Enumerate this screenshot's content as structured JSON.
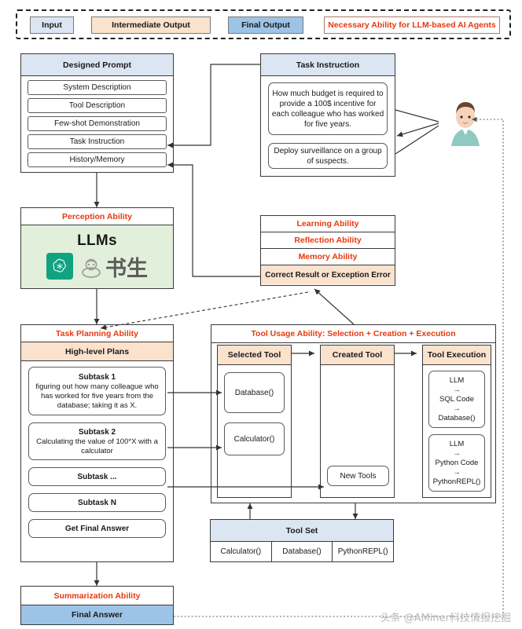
{
  "legend": {
    "input": "Input",
    "intermediate": "Intermediate Output",
    "final": "Final Output",
    "necessary": "Necessary Ability for LLM-based AI Agents",
    "colors": {
      "input": "#dce6f2",
      "intermediate": "#fbe2cd",
      "final": "#9dc3e6",
      "ability_text": "#e8380d"
    }
  },
  "designed_prompt": {
    "title": "Designed Prompt",
    "items": [
      "System Description",
      "Tool Description",
      "Few-shot Demonstration",
      "Task Instruction",
      "History/Memory"
    ]
  },
  "task_instruction": {
    "title": "Task Instruction",
    "items": [
      "How much budget is required to provide a 100$ incentive for each colleague who has worked for five years.",
      "Deploy surveillance on a group of suspects."
    ]
  },
  "perception": {
    "title": "Perception Ability",
    "model_label": "LLMs",
    "logos": [
      "openai-logo",
      "internlm-logo"
    ],
    "internlm_text": "书生",
    "background": "#e2efda"
  },
  "abilities": {
    "learning": "Learning Ability",
    "reflection": "Reflection Ability",
    "memory": "Memory Ability",
    "result": "Correct Result or Exception Error"
  },
  "task_planning": {
    "title": "Task Planning Ability",
    "subtitle": "High-level Plans",
    "subtasks": [
      {
        "title": "Subtask 1",
        "body": "figuring out how many colleague who has worked for five years from the database; taking it as X."
      },
      {
        "title": "Subtask 2",
        "body": "Calculating the value of 100*X with a calculator"
      },
      {
        "title": "Subtask ...",
        "body": ""
      },
      {
        "title": "Subtask N",
        "body": ""
      },
      {
        "title": "Get Final Answer",
        "body": ""
      }
    ]
  },
  "tool_usage": {
    "title": "Tool Usage Ability: Selection + Creation + Execution",
    "columns": [
      {
        "header": "Selected Tool",
        "items": [
          "Database()",
          "Calculator()"
        ]
      },
      {
        "header": "Created Tool",
        "items": [
          "New Tools"
        ]
      },
      {
        "header": "Tool Execution",
        "items": [
          "LLM\n→\nSQL Code\n→\nDatabase()",
          "LLM\n→\nPython Code\n→\nPythonREPL()"
        ]
      }
    ]
  },
  "tool_execution_boxes": [
    [
      "LLM",
      "→",
      "SQL Code",
      "→",
      "Database()"
    ],
    [
      "LLM",
      "→",
      "Python Code",
      "→",
      "PythonREPL()"
    ]
  ],
  "tool_set": {
    "title": "Tool Set",
    "items": [
      "Calculator()",
      "Database()",
      "PythonREPL()"
    ]
  },
  "summarization": {
    "title": "Summarization Ability",
    "final_answer": "Final Answer"
  },
  "watermark": "头条 @AMiner科技情报挖掘"
}
